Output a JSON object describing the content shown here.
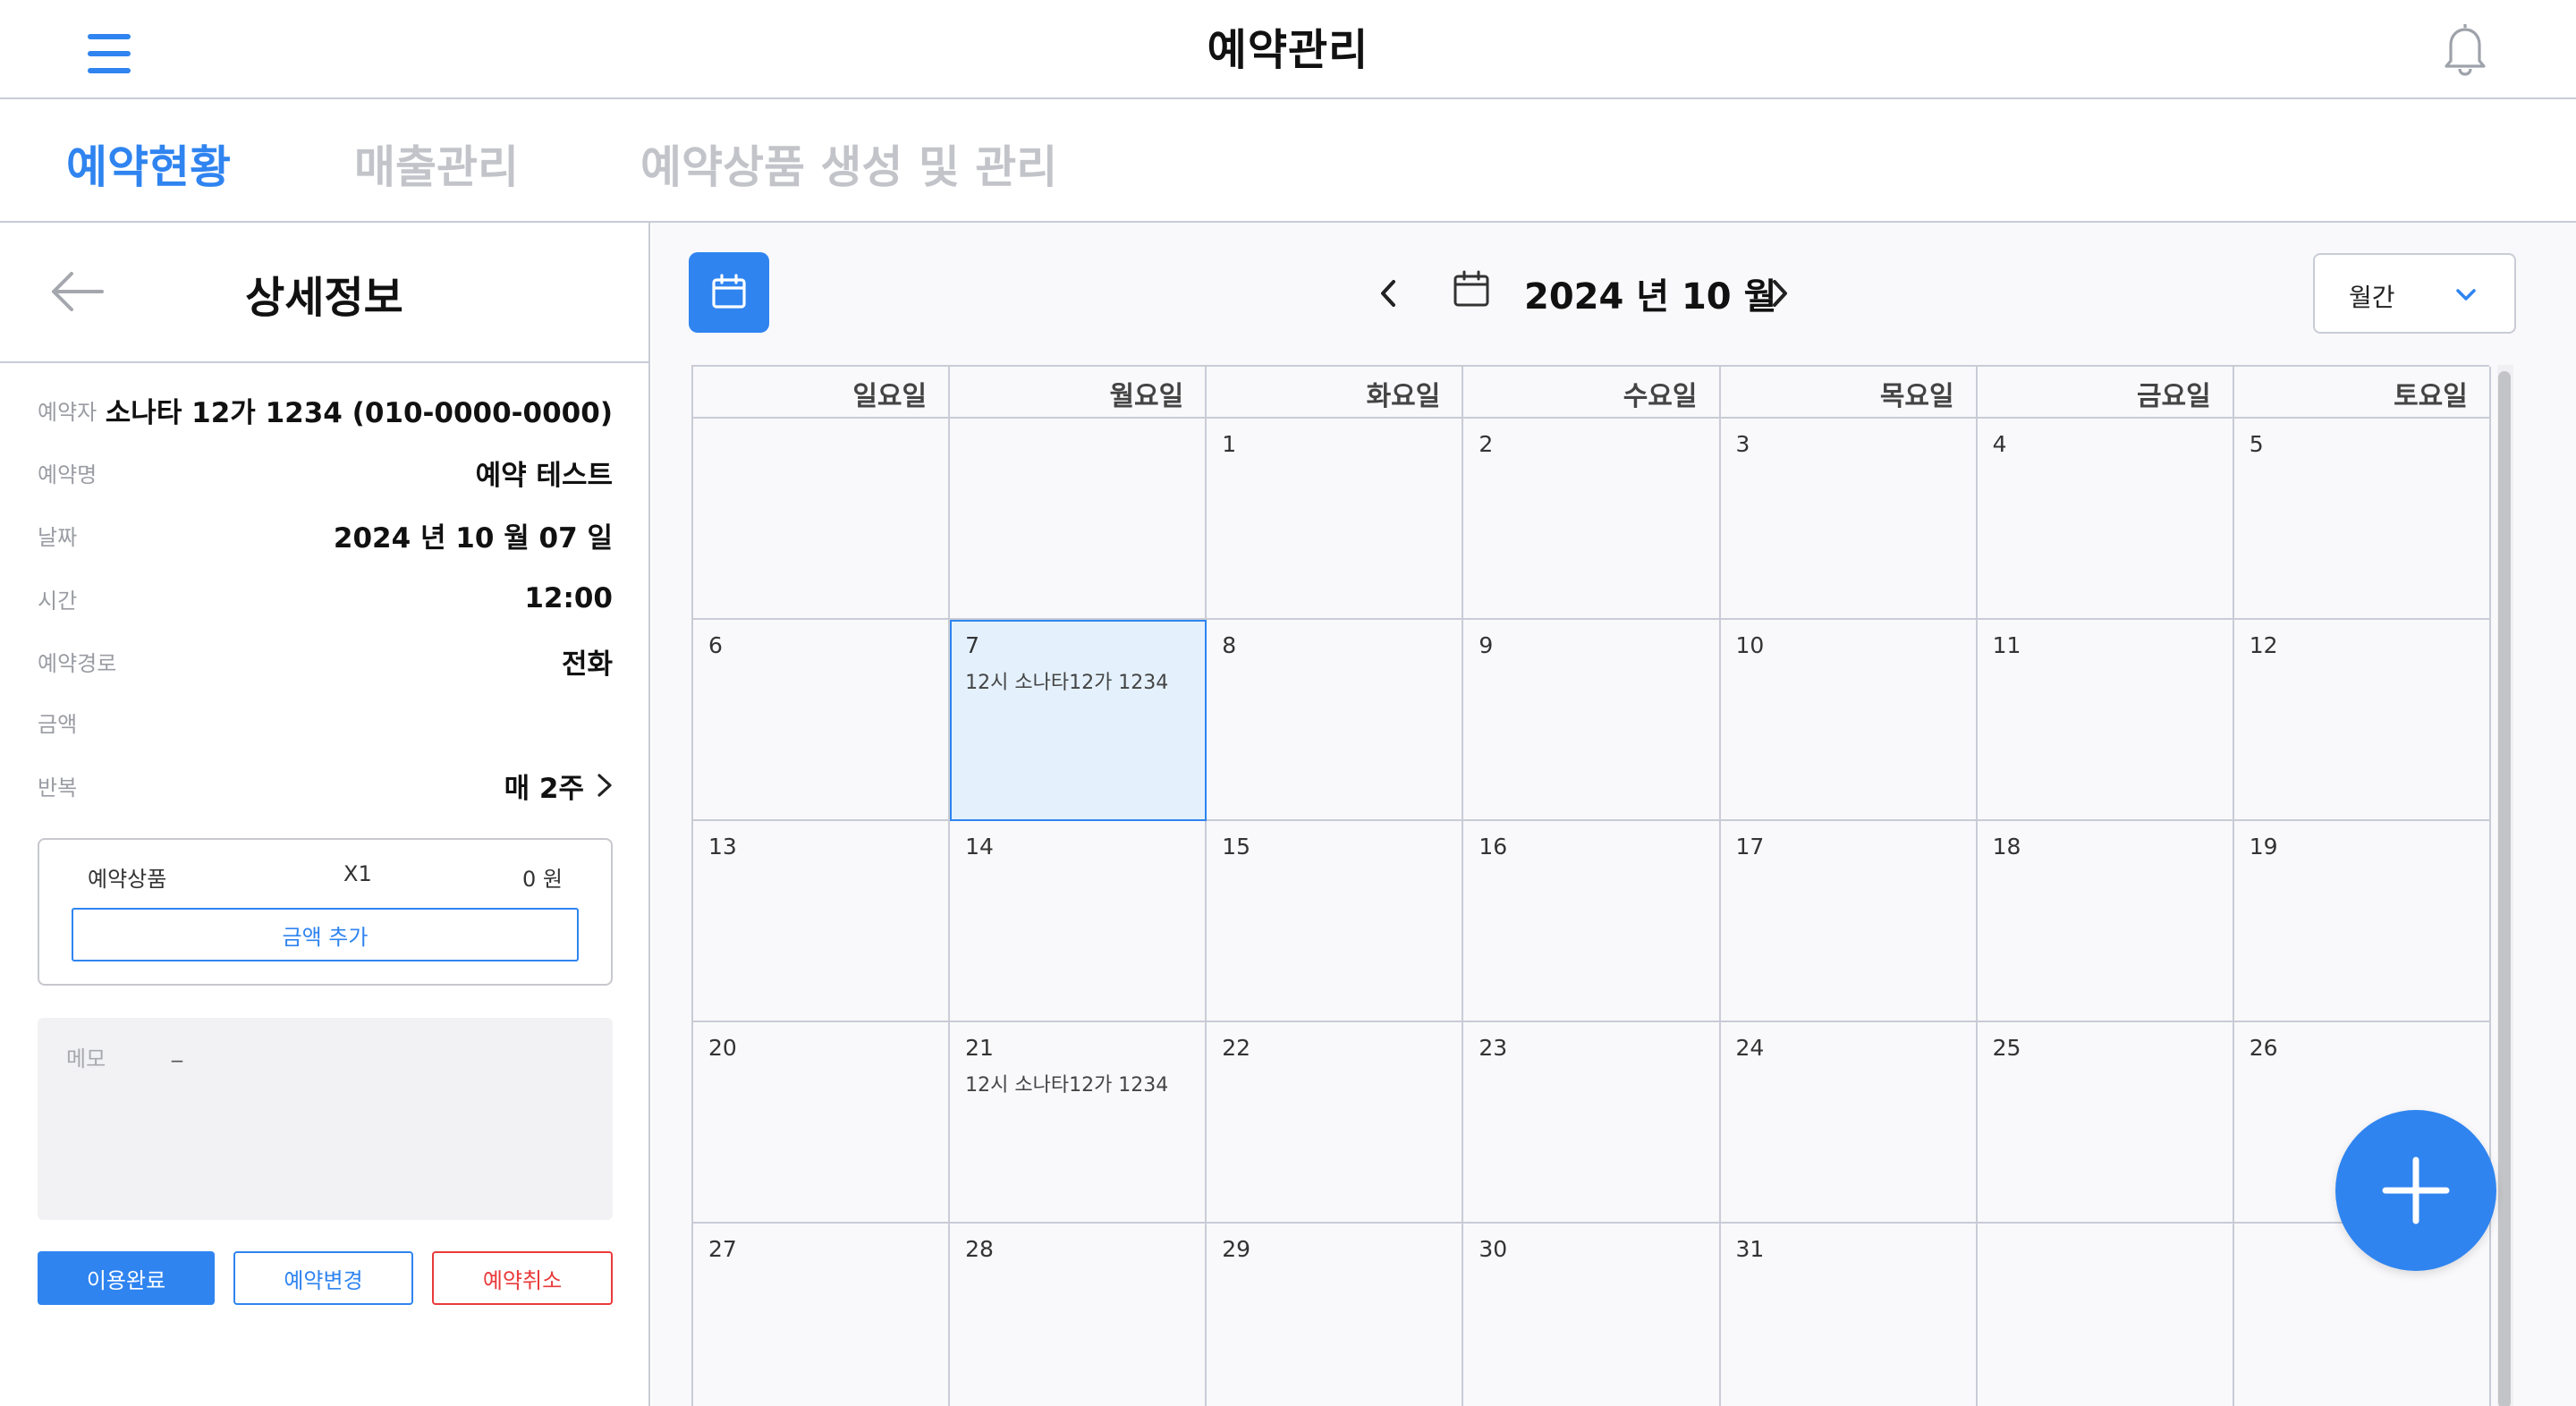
{
  "app": {
    "title": "예약관리"
  },
  "tabs": [
    {
      "label": "예약현황",
      "active": true
    },
    {
      "label": "매출관리",
      "active": false
    },
    {
      "label": "예약상품 생성 및 관리",
      "active": false
    }
  ],
  "detail": {
    "title": "상세정보",
    "rows": [
      {
        "label": "예약자",
        "value": "소나타 12가 1234 (010-0000-0000)"
      },
      {
        "label": "예약명",
        "value": "예약 테스트"
      },
      {
        "label": "날짜",
        "value": "2024 년 10 월 07 일"
      },
      {
        "label": "시간",
        "value": "12:00"
      },
      {
        "label": "예약경로",
        "value": "전화"
      },
      {
        "label": "금액",
        "value": ""
      },
      {
        "label": "반복",
        "value": "매 2주"
      }
    ],
    "product": {
      "name": "예약상품",
      "qty": "X1",
      "price": "0 원",
      "add_button": "금액 추가"
    },
    "memo": {
      "label": "메모",
      "value": "_"
    },
    "buttons": {
      "done": "이용완료",
      "change": "예약변경",
      "cancel": "예약취소"
    }
  },
  "calendar": {
    "month_label": "2024 년  10 월",
    "view_mode": "월간",
    "weekdays": [
      "일요일",
      "월요일",
      "화요일",
      "수요일",
      "목요일",
      "금요일",
      "토요일"
    ],
    "days": [
      "",
      "",
      "1",
      "2",
      "3",
      "4",
      "5",
      "6",
      "7",
      "8",
      "9",
      "10",
      "11",
      "12",
      "13",
      "14",
      "15",
      "16",
      "17",
      "18",
      "19",
      "20",
      "21",
      "22",
      "23",
      "24",
      "25",
      "26",
      "27",
      "28",
      "29",
      "30",
      "31",
      "",
      ""
    ],
    "selected_day": "7",
    "events": {
      "7": "12시 소나타12가 1234",
      "21": "12시 소나타12가 1234"
    }
  },
  "colors": {
    "accent": "#2f84f0",
    "danger": "#ea3a3a",
    "selected_bg": "#e4f1fd",
    "muted_tab": "#c2c4c9"
  },
  "icons": {
    "menu": "hamburger-icon",
    "bell": "bell-icon",
    "back": "arrow-left-icon",
    "calendar": "calendar-icon",
    "prev": "chevron-left-icon",
    "next": "chevron-right-icon",
    "dropdown": "chevron-down-icon",
    "add": "plus-icon"
  }
}
